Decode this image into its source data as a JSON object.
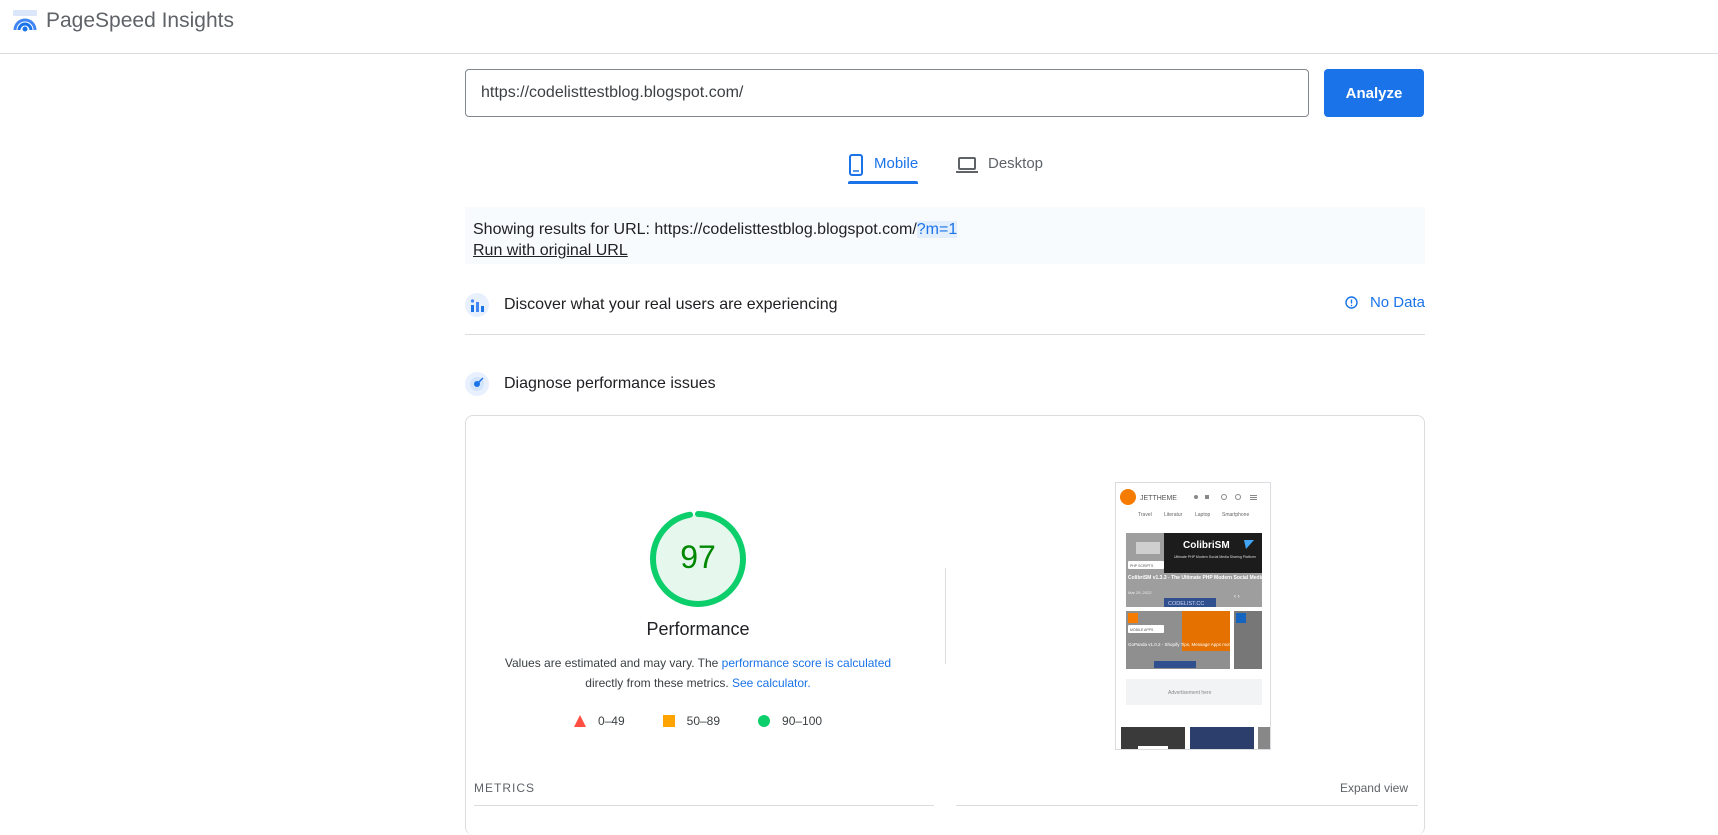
{
  "app": {
    "title": "PageSpeed Insights"
  },
  "search": {
    "value": "https://codelisttestblog.blogspot.com/",
    "analyze_label": "Analyze"
  },
  "tabs": [
    {
      "label": "Mobile",
      "selected": true,
      "icon": "phone-icon"
    },
    {
      "label": "Desktop",
      "selected": false,
      "icon": "laptop-icon"
    }
  ],
  "result": {
    "prefix": "Showing results for URL: https://codelisttestblog.blogspot.com/",
    "highlight": "?m=1",
    "run_original": "Run with original URL"
  },
  "field_data": {
    "title": "Discover what your real users are experiencing",
    "status": "No Data"
  },
  "diagnose": {
    "title": "Diagnose performance issues"
  },
  "performance": {
    "score": 97,
    "label": "Performance",
    "note_prefix": "Values are estimated and may vary. The ",
    "note_link1": "performance score is calculated",
    "note_mid": "directly from these metrics. ",
    "note_link2": "See calculator.",
    "legend": [
      {
        "range": "0–49",
        "color": "#ff4e42",
        "shape": "triangle"
      },
      {
        "range": "50–89",
        "color": "#ffa400",
        "shape": "square"
      },
      {
        "range": "90–100",
        "color": "#0cce6b",
        "shape": "circle"
      }
    ]
  },
  "screenshot": {
    "brand": "JETTHEME",
    "nav": [
      "Travel",
      "Literatur",
      "Laptop",
      "Smartphone"
    ],
    "hero_title": "ColibriSM",
    "hero_sub": "Ultimate PHP Modern Social Media Sharing Platform",
    "hero_tag": "PHP SCRIPTS",
    "hero_caption": "ColibriSM v1.3.3 - The Ultimate PHP Modern Social Media...",
    "hero_date": "Mar 25, 2022",
    "watermark": "CODELIST.CC",
    "card_tag": "MOBILE APPS",
    "card_caption": "GoPanda v1.0.2 - Shopify Tips, Message Apps more...",
    "ad": "Advertisement here"
  },
  "metrics": {
    "label": "METRICS",
    "expand": "Expand view"
  },
  "colors": {
    "accent": "#1a73e8",
    "pass": "#0cce6b",
    "pass_text": "#008800"
  }
}
